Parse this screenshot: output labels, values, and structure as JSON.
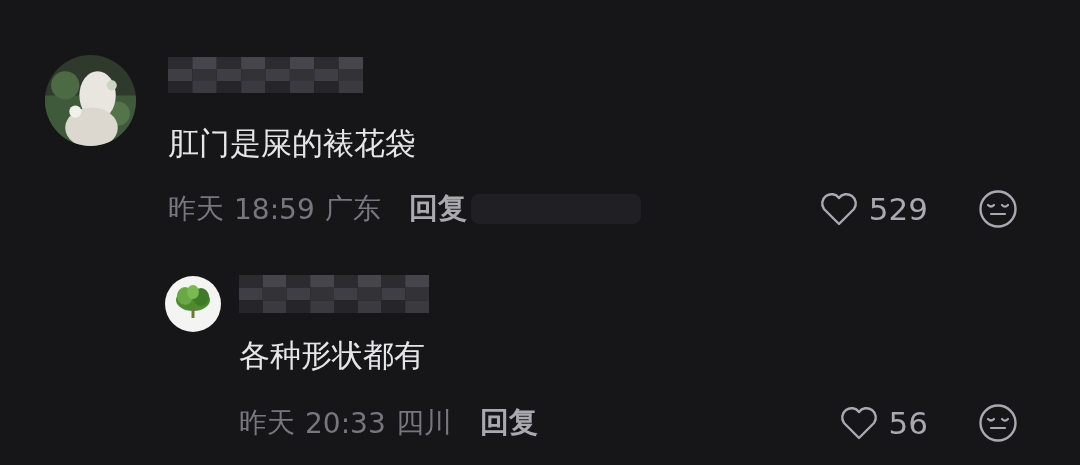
{
  "comments": [
    {
      "kind": "comment",
      "text": "肛门是屎的裱花袋",
      "date": "昨天",
      "time": "18:59",
      "location": "广东",
      "reply_label": "回复",
      "likes": "529",
      "liked": false
    },
    {
      "kind": "reply",
      "text": "各种形状都有",
      "date": "昨天",
      "time": "20:33",
      "location": "四川",
      "reply_label": "回复",
      "likes": "56",
      "liked": false
    }
  ]
}
